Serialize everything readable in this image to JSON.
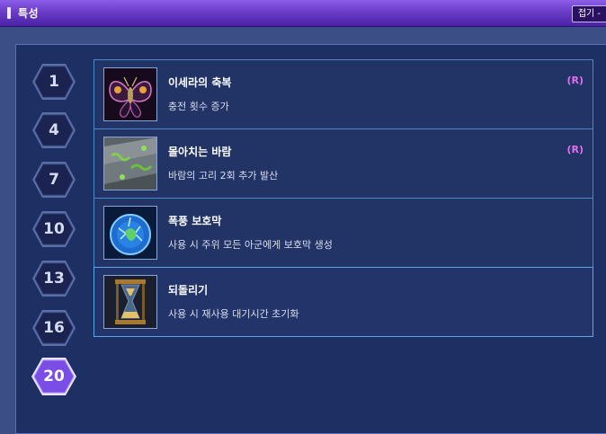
{
  "window": {
    "title": "특성",
    "collapse_label": "접기 -"
  },
  "levels": [
    {
      "label": "1",
      "active": false
    },
    {
      "label": "4",
      "active": false
    },
    {
      "label": "7",
      "active": false
    },
    {
      "label": "10",
      "active": false
    },
    {
      "label": "13",
      "active": false
    },
    {
      "label": "16",
      "active": false
    },
    {
      "label": "20",
      "active": true
    }
  ],
  "talents": [
    {
      "name": "이세라의 축복",
      "description": "충전 횟수 증가",
      "badge": "(R)",
      "icon": "moth-icon"
    },
    {
      "name": "몰아치는 바람",
      "description": "바람의 고리 2회 추가 발산",
      "badge": "(R)",
      "icon": "stone-moss-icon"
    },
    {
      "name": "폭풍 보호막",
      "description": "사용 시 주위 모든 아군에게 보호막 생성",
      "badge": "",
      "icon": "storm-shield-icon"
    },
    {
      "name": "되돌리기",
      "description": "사용 시 재사용 대기시간 초기화",
      "badge": "",
      "icon": "hourglass-icon"
    }
  ],
  "colors": {
    "title_bar": "#6a3cc8",
    "panel": "#1d2f63",
    "row_border": "#4e87c8",
    "badge": "#e070f0",
    "active_level": "#7a4ee6"
  }
}
